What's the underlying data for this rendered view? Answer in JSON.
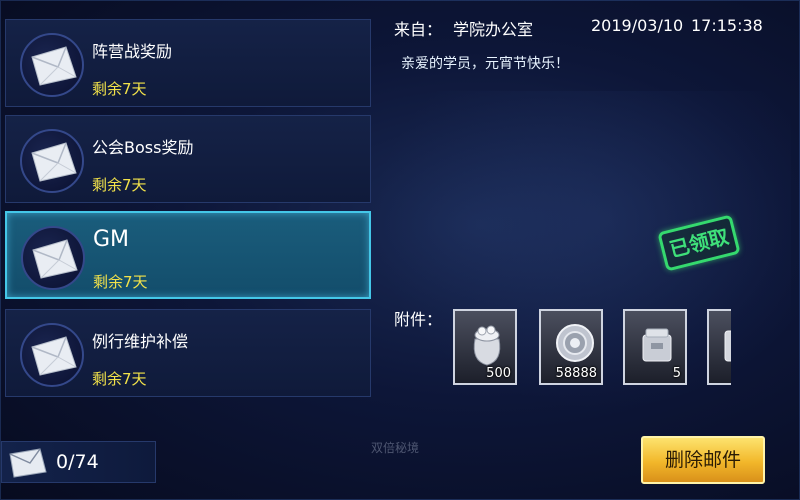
{
  "mail_list": {
    "items": [
      {
        "title": "阵营战奖励",
        "remain": "剩余7天"
      },
      {
        "title": "公会Boss奖励",
        "remain": "剩余7天"
      },
      {
        "title": "GM",
        "remain": "剩余7天"
      },
      {
        "title": "例行维护补偿",
        "remain": "剩余7天"
      }
    ],
    "selected_index": 2
  },
  "counter": {
    "text": "0/74"
  },
  "detail": {
    "from_label": "来自：",
    "from_value": "学院办公室",
    "date": "2019/03/10",
    "time": "17:15:38",
    "body": "亲爱的学员，元宵节快乐！",
    "stamp": "已领取"
  },
  "attachments": {
    "label": "附件：",
    "items": [
      {
        "icon": "coin-bag-icon",
        "count": "500"
      },
      {
        "icon": "silver-coin-icon",
        "count": "58888"
      },
      {
        "icon": "supply-box-icon",
        "count": "5"
      },
      {
        "icon": "item-icon",
        "count": ""
      }
    ]
  },
  "actions": {
    "delete_label": "删除邮件"
  },
  "background": {
    "faint_text": "双倍秘境"
  },
  "colors": {
    "remain_yellow": "#f2e24a",
    "selected_border": "#44c7e8",
    "stamp_green": "#3fe07a",
    "button_gold": "#f2b72a"
  }
}
